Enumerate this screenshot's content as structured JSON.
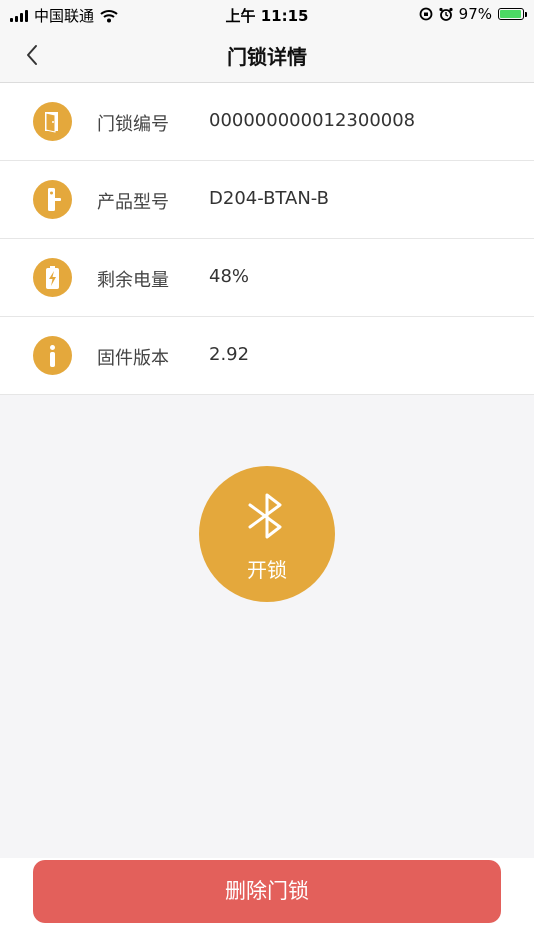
{
  "status_bar": {
    "carrier": "中国联通",
    "time": "上午 11:15",
    "battery": "97%",
    "battery_level": 0.97
  },
  "nav": {
    "title": "门锁详情",
    "back_icon": "chevron-left-icon"
  },
  "info": [
    {
      "icon": "door-icon",
      "label": "门锁编号",
      "value": "000000000012300008"
    },
    {
      "icon": "lock-handle-icon",
      "label": "产品型号",
      "value": "D204-BTAN-B"
    },
    {
      "icon": "battery-charge-icon",
      "label": "剩余电量",
      "value": "48%"
    },
    {
      "icon": "info-icon",
      "label": "固件版本",
      "value": "2.92"
    }
  ],
  "unlock": {
    "label": "开锁",
    "icon": "bluetooth-icon"
  },
  "delete": {
    "label": "删除门锁"
  },
  "colors": {
    "accent": "#e4a83c",
    "danger": "#e3605b",
    "background": "#f5f5f7"
  }
}
